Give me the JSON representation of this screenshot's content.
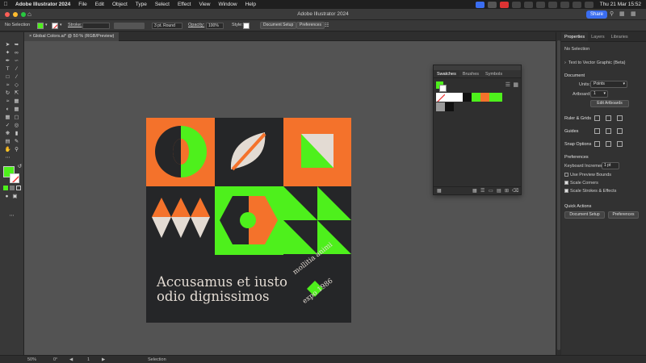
{
  "menubar": {
    "app_name": "Adobe Illustrator 2024",
    "items": [
      "File",
      "Edit",
      "Object",
      "Type",
      "Select",
      "Effect",
      "View",
      "Window",
      "Help"
    ],
    "clock": "Thu 21 Mar  15:52"
  },
  "titlebar": {
    "title": "Adobe Illustrator 2024",
    "share_label": "Share"
  },
  "control_bar": {
    "selection": "No Selection",
    "stroke_label": "Stroke:",
    "brush_value": "3 pt. Round",
    "opacity_label": "Opacity:",
    "opacity_value": "100%",
    "style_label": "Style:",
    "document_setup_label": "Document Setup",
    "preferences_label": "Preferences",
    "fill_color": "#4ef01c"
  },
  "document_tab": {
    "label": "Global Colors.ai* @ 50 % (RGB/Preview)",
    "close_glyph": "×"
  },
  "artboard": {
    "colors": {
      "orange": "#f4722b",
      "green": "#4ef01c",
      "dark": "#252628",
      "cream": "#e3dbd3"
    },
    "headline_line1": "Accusamus et iusto",
    "headline_line2": "odio dignissimos",
    "badge_top": "mollitia animi",
    "badge_bottom": "expo 1986"
  },
  "swatches_panel": {
    "tabs": [
      "Swatches",
      "Brushes",
      "Symbols"
    ],
    "active_tab": "Swatches",
    "swatch_colors": [
      "#ffffff",
      "#ffffff",
      "#ffffff",
      "#111111",
      "#4ef01c",
      "#f4722b",
      "#4ef01c"
    ],
    "row2_colors": [
      "#9a9a9a",
      "#111111"
    ]
  },
  "properties_panel": {
    "tabs": [
      "Properties",
      "Layers",
      "Libraries"
    ],
    "active_tab": "Properties",
    "no_selection": "No Selection",
    "text_to_vector": "Text to Vector Graphic (Beta)",
    "document_heading": "Document",
    "units_label": "Units:",
    "units_value": "Points",
    "artboard_label": "Artboard:",
    "artboard_value": "1",
    "edit_artboards_label": "Edit Artboards",
    "ruler_grids_heading": "Ruler & Grids",
    "guides_heading": "Guides",
    "snap_options_heading": "Snap Options",
    "preferences_heading": "Preferences",
    "keyboard_increment_label": "Keyboard Increment:",
    "keyboard_increment_value": "1 pt",
    "use_preview_bounds": "Use Preview Bounds",
    "scale_corners": "Scale Corners",
    "scale_strokes_effects": "Scale Strokes & Effects",
    "quick_actions_heading": "Quick Actions",
    "document_setup_label": "Document Setup",
    "preferences_label": "Preferences"
  },
  "status_bar": {
    "zoom": "50%",
    "rotation": "0°",
    "artboard_number": "1",
    "tool": "Selection"
  }
}
